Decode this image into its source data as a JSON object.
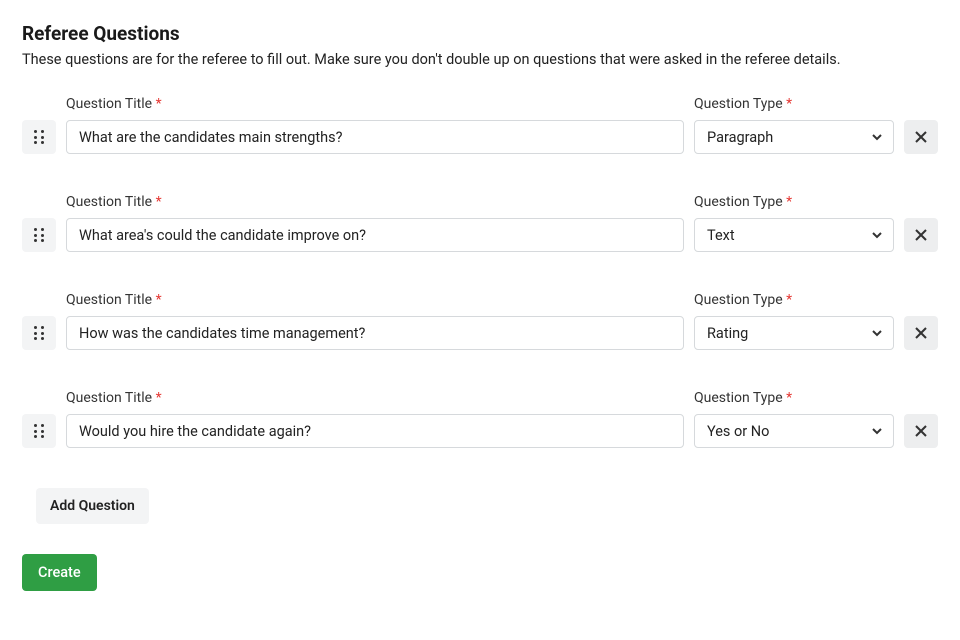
{
  "header": {
    "title": "Referee Questions",
    "subtitle": "These questions are for the referee to fill out. Make sure you don't double up on questions that were asked in the referee details."
  },
  "labels": {
    "question_title": "Question Title",
    "question_type": "Question Type",
    "required_mark": "*",
    "add_question": "Add Question",
    "create": "Create"
  },
  "questions": [
    {
      "title": "What are the candidates main strengths?",
      "type": "Paragraph"
    },
    {
      "title": "What area's could the candidate improve on?",
      "type": "Text"
    },
    {
      "title": "How was the candidates time management?",
      "type": "Rating"
    },
    {
      "title": "Would you hire the candidate again?",
      "type": "Yes or No"
    }
  ],
  "type_options": [
    "Paragraph",
    "Text",
    "Rating",
    "Yes or No"
  ]
}
